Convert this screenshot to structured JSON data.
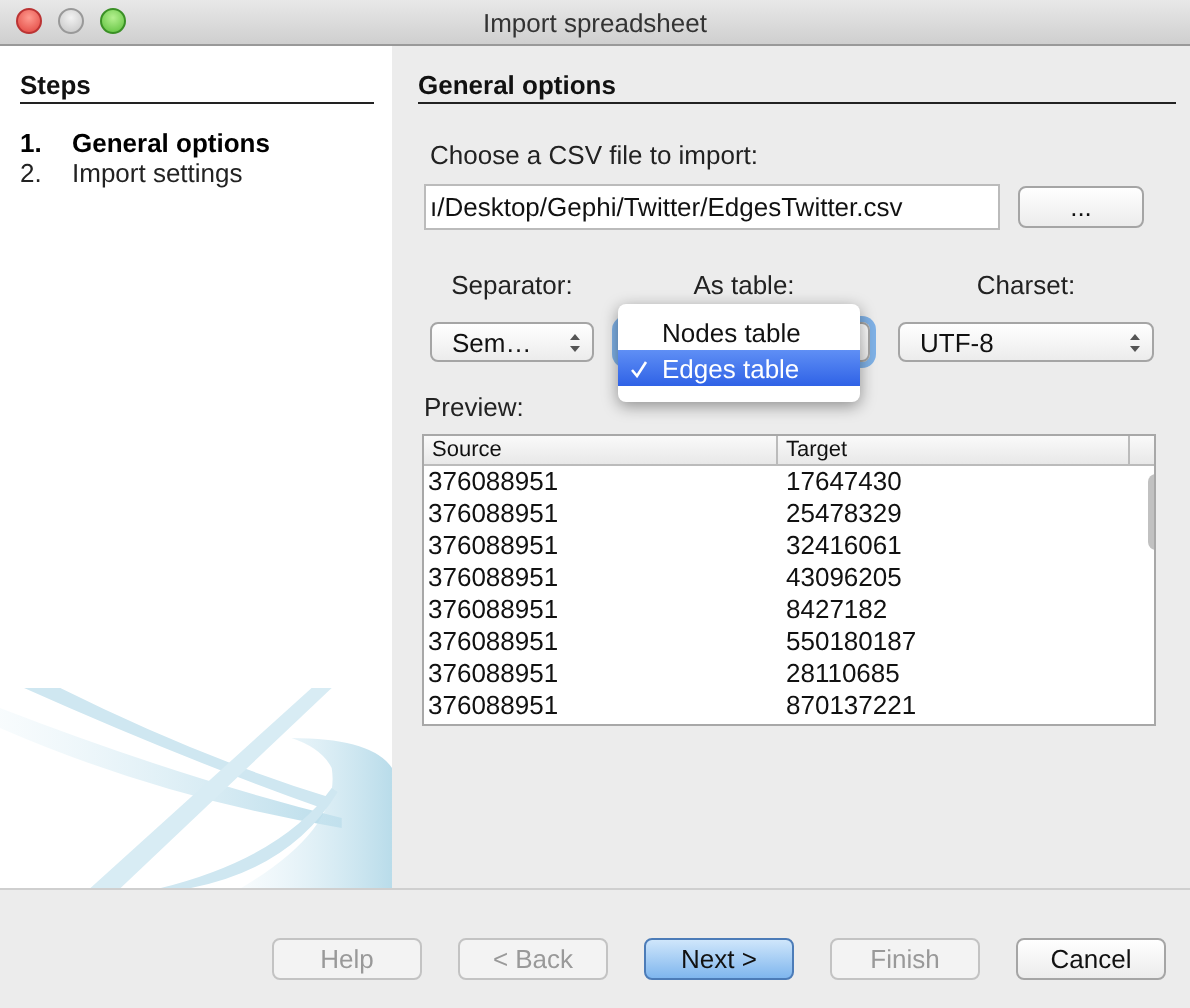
{
  "window": {
    "title": "Import spreadsheet"
  },
  "steps": {
    "title": "Steps",
    "items": [
      {
        "number": "1.",
        "label": "General options",
        "selected": true
      },
      {
        "number": "2.",
        "label": "Import settings",
        "selected": false
      }
    ]
  },
  "panel": {
    "title": "General options",
    "file_label": "Choose a CSV file to import:",
    "file_value": "ı/Desktop/Gephi/Twitter/EdgesTwitter.csv",
    "browse_button": "...",
    "separator": {
      "label": "Separator:",
      "value": "Sem…"
    },
    "as_table": {
      "label": "As table:",
      "options": [
        {
          "label": "Nodes table",
          "selected": false
        },
        {
          "label": "Edges table",
          "selected": true
        }
      ]
    },
    "charset": {
      "label": "Charset:",
      "value": "UTF-8"
    },
    "preview_label": "Preview:",
    "table": {
      "columns": [
        "Source",
        "Target"
      ],
      "rows": [
        [
          "376088951",
          "17647430"
        ],
        [
          "376088951",
          "25478329"
        ],
        [
          "376088951",
          "32416061"
        ],
        [
          "376088951",
          "43096205"
        ],
        [
          "376088951",
          "8427182"
        ],
        [
          "376088951",
          "550180187"
        ],
        [
          "376088951",
          "28110685"
        ],
        [
          "376088951",
          "870137221"
        ]
      ]
    }
  },
  "buttons": [
    {
      "label": "Help",
      "disabled": true,
      "default": false
    },
    {
      "label": "< Back",
      "disabled": true,
      "default": false
    },
    {
      "label": "Next >",
      "disabled": false,
      "default": true
    },
    {
      "label": "Finish",
      "disabled": true,
      "default": false
    },
    {
      "label": "Cancel",
      "disabled": false,
      "default": false
    }
  ]
}
